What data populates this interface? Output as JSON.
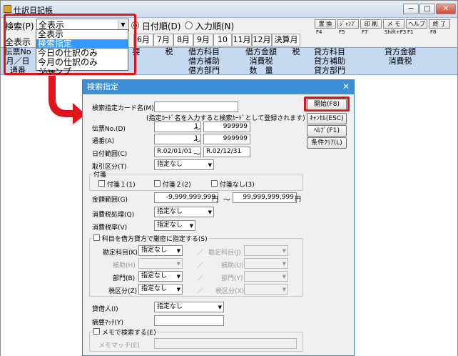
{
  "window": {
    "title": "仕訳日記帳",
    "btn_min": "─",
    "btn_max": "□",
    "btn_close": "✕"
  },
  "toolbar": {
    "search_label": "検索(P)",
    "search_value": "全表示",
    "radio_date": "日付順(D)",
    "radio_input": "入力順(N)",
    "display_label": "全表示"
  },
  "fkeys": [
    {
      "label": "置 換",
      "key": "F4"
    },
    {
      "label": "ｼﾞｬﾝﾌﾟ",
      "key": "F5"
    },
    {
      "label": "印 刷",
      "key": "F7"
    },
    {
      "label": "メ モ",
      "key": "Shift+F3"
    },
    {
      "label": "ヘルプ",
      "key": "F1"
    },
    {
      "label": "終 了",
      "key": "F8"
    }
  ],
  "months": [
    "6月",
    "7月",
    "8月",
    "9月",
    "10月",
    "11月",
    "12月",
    "決算月"
  ],
  "grid": {
    "left": [
      "伝票No",
      "月／日",
      "通番"
    ],
    "col_yo": "要",
    "col_tax": "税",
    "debit_subject": [
      "借方科目",
      "借方補助",
      "借方部門"
    ],
    "debit_amount": [
      "借方金額",
      "消費税",
      "数　量"
    ],
    "col_tax2": "税",
    "credit_subject": [
      "貸方科目",
      "貸方補助",
      "貸方部門"
    ],
    "credit_amount": [
      "貸方金額",
      "消費税"
    ],
    "row_partial": "付箋"
  },
  "dropdown_list": [
    "全表示",
    "検索指定",
    "今日の仕訳のみ",
    "今月の仕訳のみ",
    "ジャンプ"
  ],
  "dropdown_selected": 1,
  "dialog": {
    "title": "検索指定",
    "close": "✕",
    "card_name_label": "検索指定カード名(M)",
    "card_name_note": "(指定ｶｰﾄﾞ名を入力すると検索ｶｰﾄﾞとして登録されます)",
    "slip_label": "伝票No.(D)",
    "slip_from": "1",
    "slip_to": "999999",
    "serial_label": "通番(A)",
    "serial_from": "1",
    "serial_to": "999999",
    "date_label": "日付範囲(C)",
    "date_from": "R.02/01/01",
    "date_to": "R.02/12/31",
    "range_sep": "～",
    "kubun_label": "取引区分(T)",
    "kubun_value": "指定なし",
    "fusen_group": "付箋",
    "fusen1": "付箋１(1)",
    "fusen2": "付箋２(2)",
    "fusen_none": "付箋なし(3)",
    "amount_label": "金額範囲(G)",
    "amount_from": "-9,999,999,999",
    "amount_to": "99,999,999,999",
    "yen": "円",
    "tax_proc_label": "消費税処理(Q)",
    "tax_proc_value": "指定なし",
    "tax_rate_label": "消費税率(V)",
    "tax_rate_value": "指定なし",
    "strict_label": "科目を借方貸方で厳密に指定する(S)",
    "acct_label": "勘定科目(K)",
    "acct_value": "指定なし",
    "acct_right_label": "勘定科目(J)",
    "sub_label": "補助(H)",
    "sub_right_label": "補助(U)",
    "dept_label": "部門(B)",
    "dept_value": "指定なし",
    "dept_right_label": "部門(Y)",
    "taxcls_label": "税区分(Z)",
    "taxcls_value": "指定なし",
    "taxcls_right_label": "税区分(X)",
    "slash": "／",
    "lender_label": "貸借人(I)",
    "lender_value": "指定なし",
    "memo_match_label": "摘要ﾏｯﾁ(Y)",
    "memo_search_label": "メモで検索する(E)",
    "memo_match2_label": "メモマッチ(E)",
    "btn_start": "開始(F8)",
    "btn_cancel": "ｷｬﾝｾﾙ(ESC)",
    "btn_help": "ﾍﾙﾌﾟ(F1)",
    "btn_clear": "条件ｸﾘｱ(L)"
  },
  "colors": {
    "highlight": "#e0141b",
    "dialog_title": "#3c8fd6",
    "grid_header": "#c5d9f1",
    "selection": "#3399ff"
  }
}
